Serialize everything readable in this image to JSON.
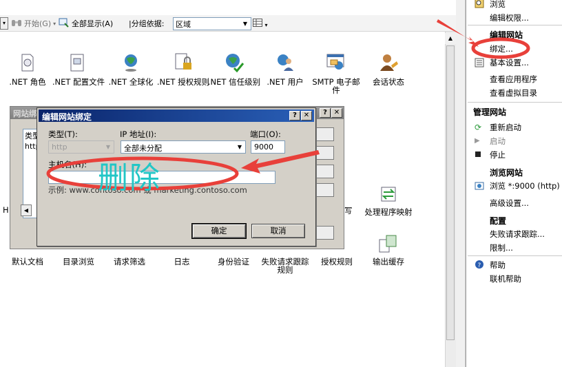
{
  "toolbar": {
    "start_label": "开始(G)",
    "show_all_label": "全部显示(A)",
    "group_by_label": "|分组依据:",
    "group_by_value": "区域"
  },
  "features_row1": [
    {
      "label": ".NET 角色",
      "icon": "net-roles-icon"
    },
    {
      "label": ".NET 配置文件",
      "icon": "net-profile-icon"
    },
    {
      "label": ".NET 全球化",
      "icon": "net-globalization-icon"
    },
    {
      "label": ".NET 授权规则",
      "icon": "net-authorization-icon"
    },
    {
      "label": ".NET 信任级别",
      "icon": "net-trust-icon"
    },
    {
      "label": ".NET 用户",
      "icon": "net-users-icon"
    },
    {
      "label": "SMTP 电子邮件",
      "icon": "smtp-email-icon"
    },
    {
      "label": "会话状态",
      "icon": "session-state-icon"
    }
  ],
  "features_row2_partial": {
    "left_fragment": "H",
    "mid_fragment": "写",
    "handler_mappings": "处理程序映射"
  },
  "features_row3": [
    {
      "label": "默认文档",
      "icon": "default-document-icon"
    },
    {
      "label": "目录浏览",
      "icon": "directory-browsing-icon"
    },
    {
      "label": "请求筛选",
      "icon": "request-filtering-icon"
    },
    {
      "label": "日志",
      "icon": "logging-icon"
    },
    {
      "label": "身份验证",
      "icon": "authentication-icon"
    },
    {
      "label": "失败请求跟踪规则",
      "icon": "failed-request-icon"
    },
    {
      "label": "授权规则",
      "icon": "authorization-rules-icon"
    },
    {
      "label": "输出缓存",
      "icon": "output-cache-icon"
    }
  ],
  "actions": {
    "browse": "浏览",
    "edit_permissions": "编辑权限...",
    "edit_site_header": "编辑网站",
    "bindings": "绑定...",
    "basic_settings": "基本设置...",
    "view_applications": "查看应用程序",
    "view_virtual_dirs": "查看虚拟目录",
    "manage_site_header": "管理网站",
    "restart": "重新启动",
    "start": "启动",
    "stop": "停止",
    "browse_site_header": "浏览网站",
    "browse_port": "浏览 *:9000 (http)",
    "advanced_settings": "高级设置...",
    "config_header": "配置",
    "failed_request_tracing": "失败请求跟踪...",
    "limits": "限制...",
    "help": "帮助",
    "online_help": "联机帮助"
  },
  "bg_dialog": {
    "title": "网站绑定",
    "col_type": "类型",
    "row_value": "http"
  },
  "dialog": {
    "title": "编辑网站绑定",
    "type_label": "类型(T):",
    "type_value": "http",
    "ip_label": "IP 地址(I):",
    "ip_value": "全部未分配",
    "port_label": "端口(O):",
    "port_value": "9000",
    "hostname_label": "主机名(H):",
    "hostname_value": "",
    "example_text": "示例: www.contoso.com 或 marketing.contoso.com",
    "ok_label": "确定",
    "cancel_label": "取消"
  },
  "annotation": {
    "delete_text": "删除",
    "color": "#e8403a"
  }
}
